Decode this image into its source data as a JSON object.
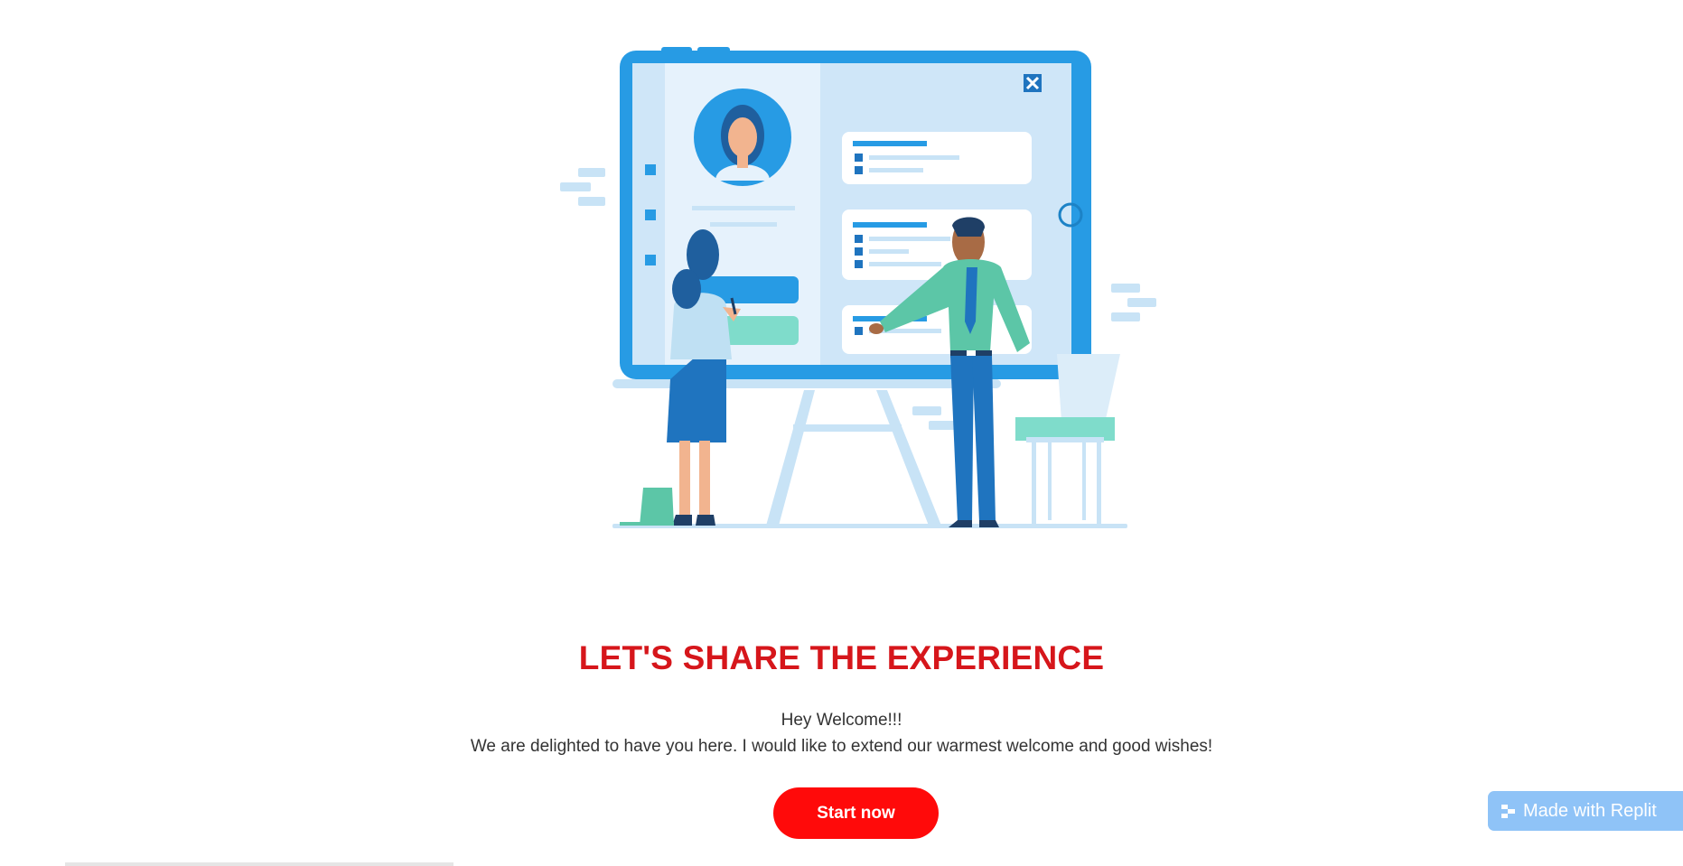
{
  "illustration": {
    "name": "presentation-illustration",
    "colors": {
      "board_blue": "#279be4",
      "panel_light": "#cfe6f8",
      "accent_teal": "#7fdccb",
      "person_blue": "#1f74bf"
    }
  },
  "hero": {
    "headline": "LET'S SHARE THE EXPERIENCE",
    "greeting": "Hey Welcome!!!",
    "message": "We are delighted to have you here. I would like to extend our warmest welcome and good wishes!",
    "cta_label": "Start now"
  },
  "badge": {
    "label": "Made with Replit",
    "icon": "replit-icon"
  },
  "colors": {
    "headline": "#d6161b",
    "cta": "#ff0a0a",
    "badge": "#8fc3f7"
  }
}
